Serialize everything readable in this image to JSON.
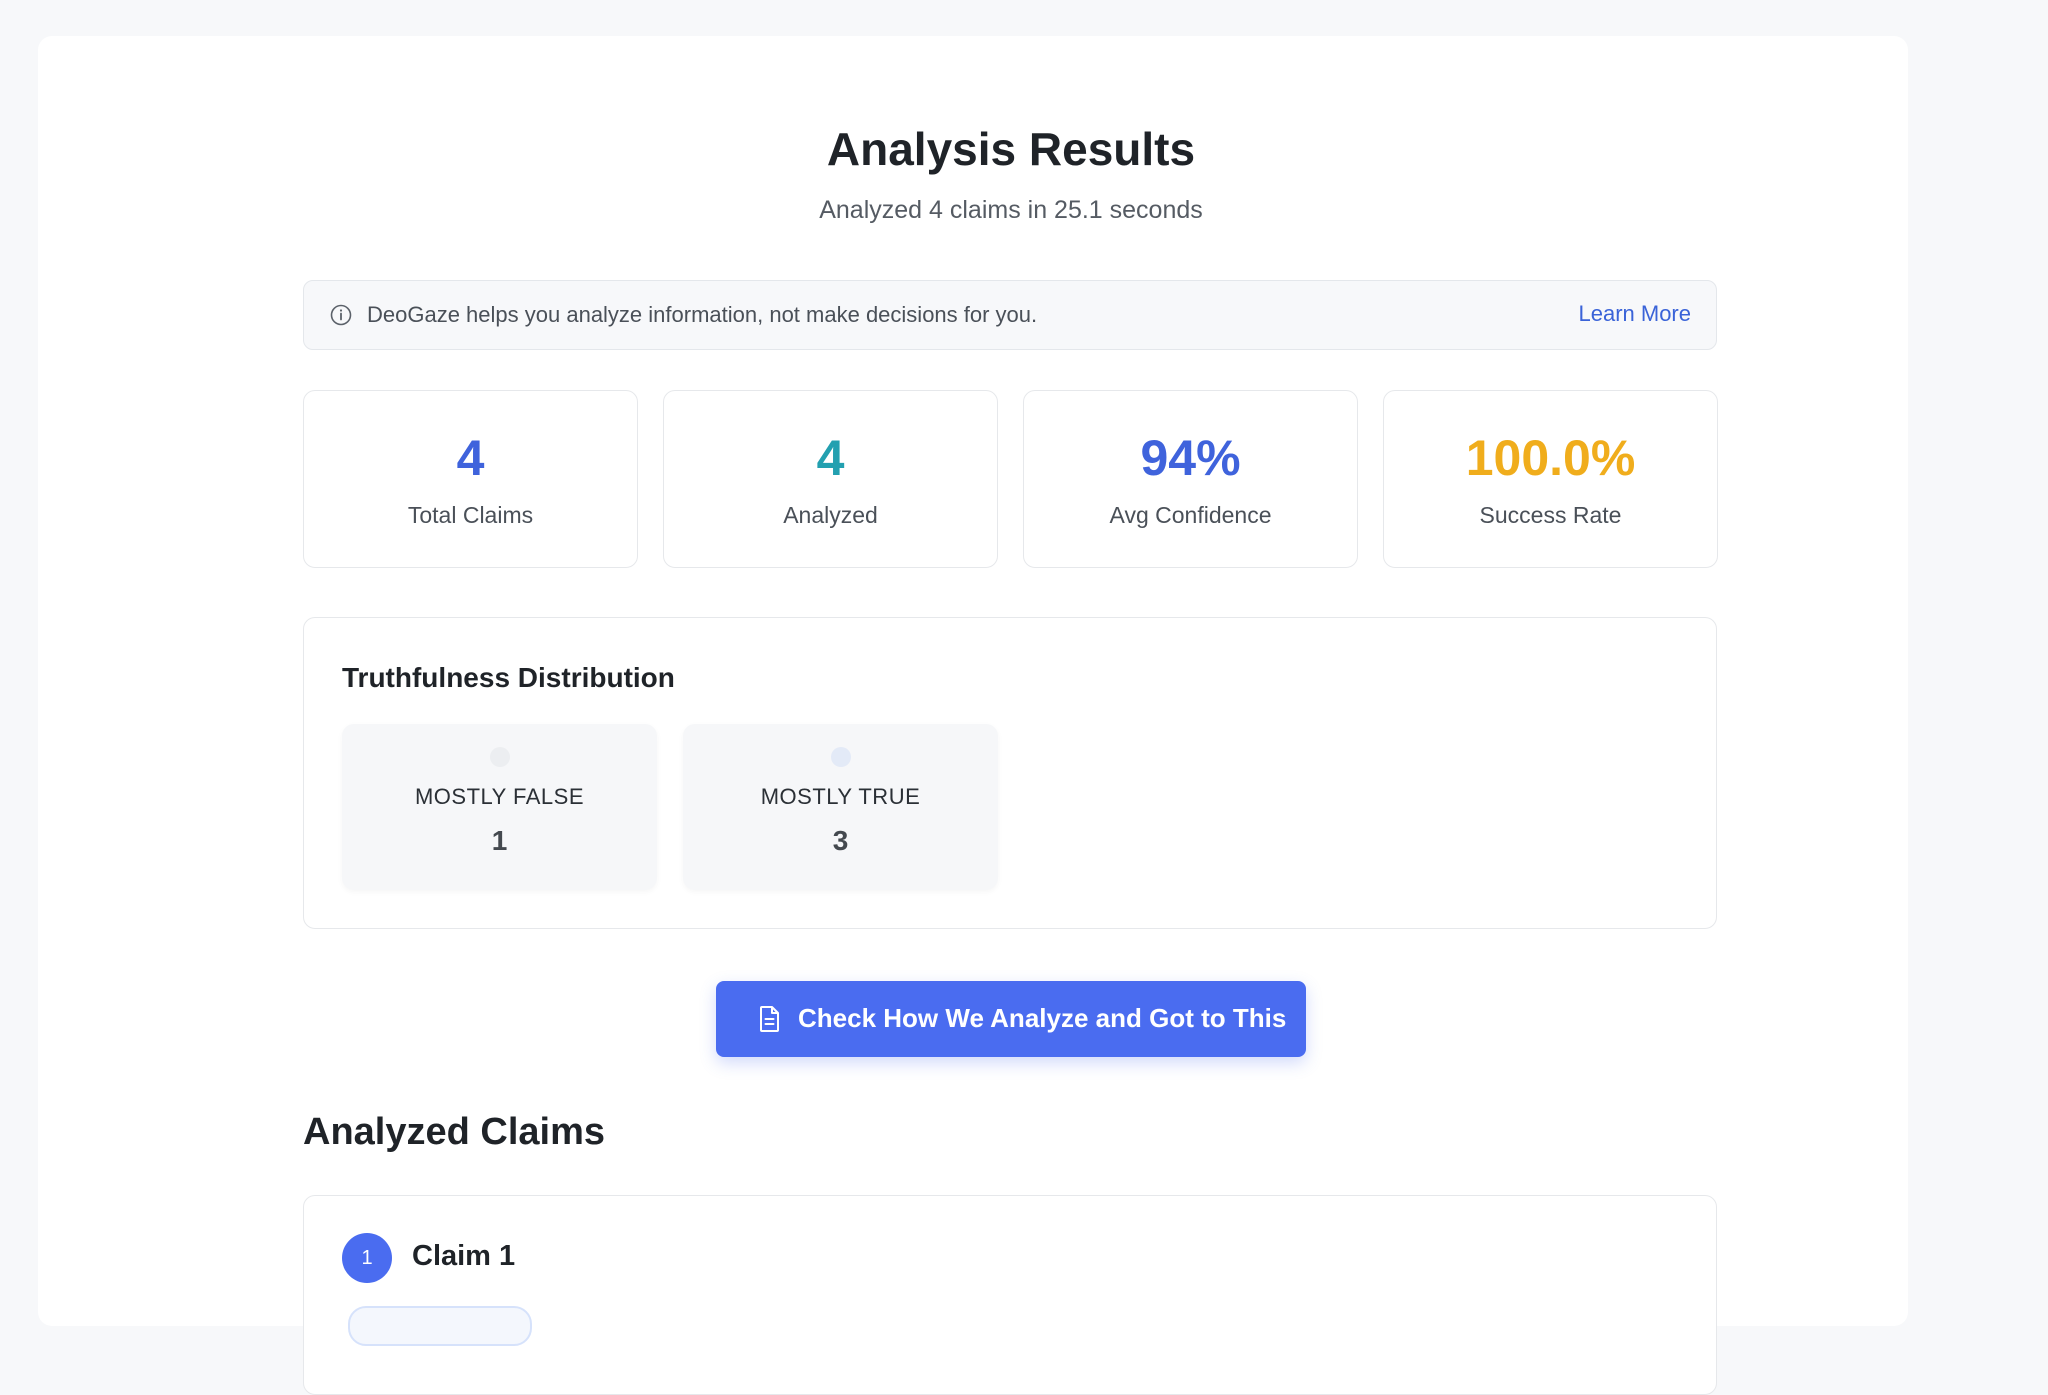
{
  "header": {
    "title": "Analysis Results",
    "subtitle": "Analyzed 4 claims in 25.1 seconds"
  },
  "notice": {
    "icon": "info-icon",
    "message": "DeoGaze helps you analyze information, not make decisions for you.",
    "link_label": "Learn More"
  },
  "stats": [
    {
      "value": "4",
      "label": "Total Claims",
      "color": "#3f63dc"
    },
    {
      "value": "4",
      "label": "Analyzed",
      "color": "#23a0b0"
    },
    {
      "value": "94%",
      "label": "Avg Confidence",
      "color": "#3f63dc"
    },
    {
      "value": "100.0%",
      "label": "Success Rate",
      "color": "#f0ad1c"
    }
  ],
  "distribution": {
    "title": "Truthfulness Distribution",
    "items": [
      {
        "label": "MOSTLY FALSE",
        "count": "1",
        "dot_color": "#eceef1"
      },
      {
        "label": "MOSTLY TRUE",
        "count": "3",
        "dot_color": "#e3eaf7"
      }
    ]
  },
  "cta": {
    "icon": "document-icon",
    "label": "Check How We Analyze and Got to This"
  },
  "claims_section": {
    "title": "Analyzed Claims",
    "claims": [
      {
        "number": "1",
        "title": "Claim 1"
      }
    ]
  },
  "colors": {
    "accent": "#4a6cf0",
    "link": "#3a63d8"
  }
}
